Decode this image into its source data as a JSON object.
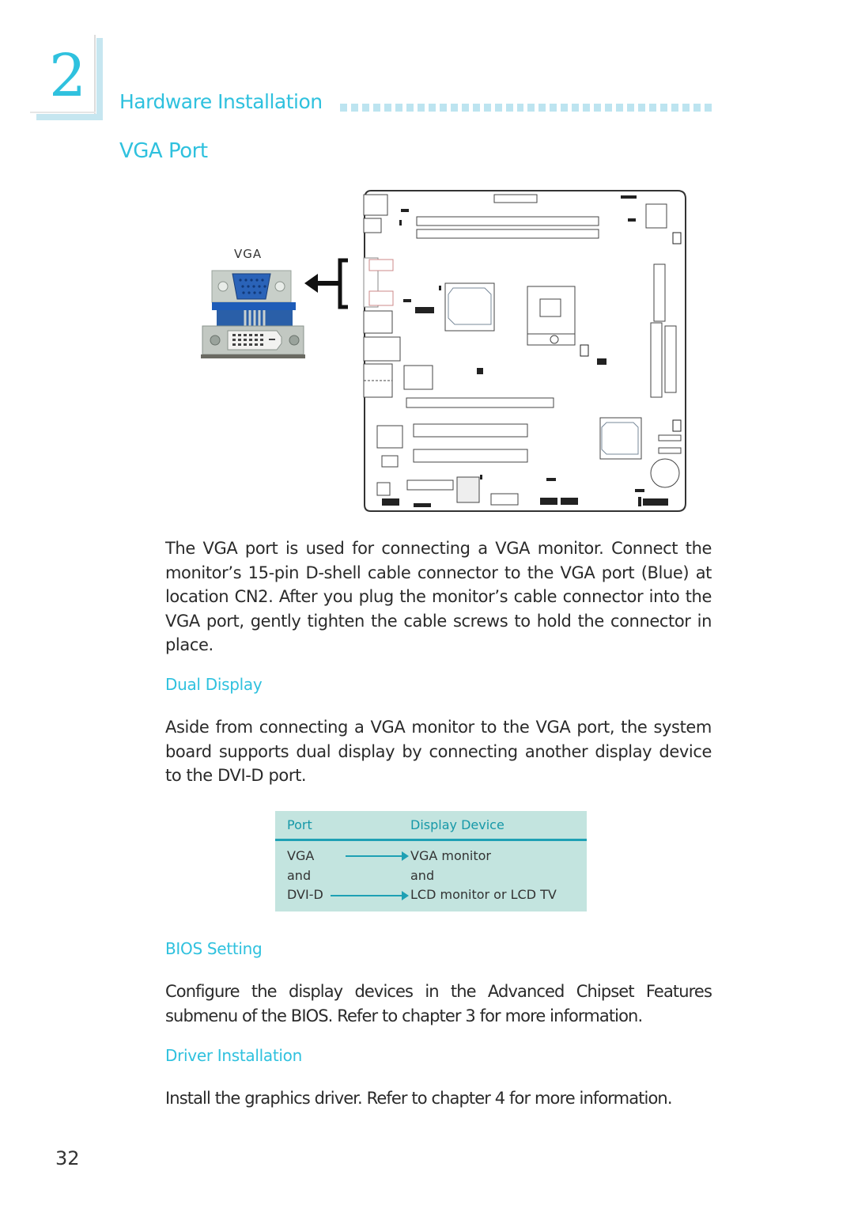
{
  "chapter": {
    "number": "2",
    "title": "Hardware Installation"
  },
  "section": {
    "title": "VGA Port"
  },
  "figure": {
    "connector_label": "VGA",
    "colors": {
      "vga_blue": "#2a63b8",
      "board_outline": "#333333",
      "accent": "#2fc1de"
    }
  },
  "intro_paragraph": "The VGA port is used for connecting a VGA monitor. Connect the monitor’s 15-pin D-shell cable connector to the VGA port (Blue) at location CN2. After you plug the monitor’s cable connector into the VGA port, gently tighten the cable screws to hold the connector in place.",
  "dual_display": {
    "heading": "Dual Display",
    "paragraph": "Aside from connecting a VGA monitor to the VGA port, the system board supports dual display by connecting another display device to the DVI-D port.",
    "table": {
      "headers": {
        "port": "Port",
        "device": "Display Device"
      },
      "rows": [
        {
          "port": "VGA",
          "device": "VGA  monitor",
          "arrow": true
        },
        {
          "port": "and",
          "device": "and",
          "arrow": false
        },
        {
          "port": "DVI-D",
          "device": "LCD  monitor  or  LCD  TV",
          "arrow": true
        }
      ]
    }
  },
  "bios_setting": {
    "heading": "BIOS Setting",
    "paragraph": "Configure the display devices in the Advanced Chipset Features submenu of the BIOS. Refer to chapter 3 for more information."
  },
  "driver_installation": {
    "heading": "Driver Installation",
    "paragraph": "Install the graphics driver. Refer to chapter 4 for more information."
  },
  "page_number": "32"
}
